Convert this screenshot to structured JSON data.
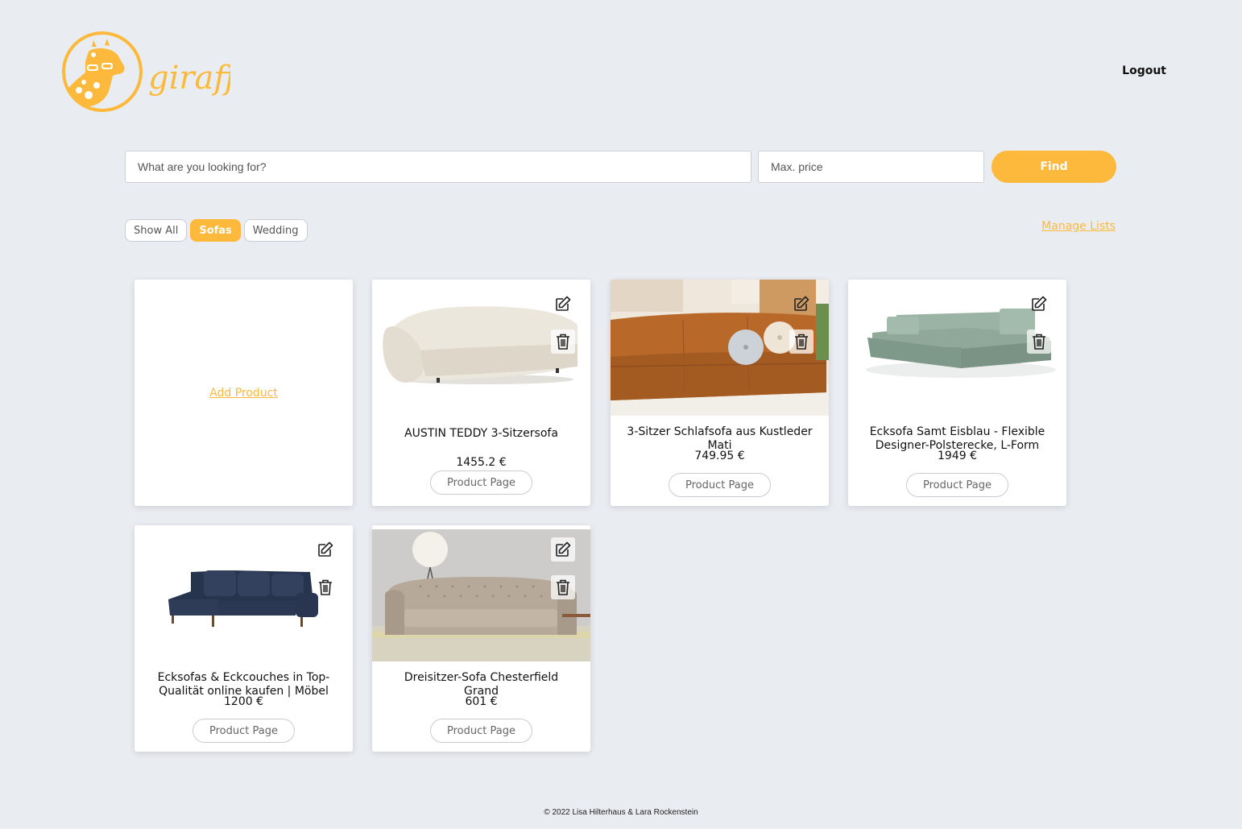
{
  "brand": {
    "name": "giraffe",
    "color": "#fdb93b"
  },
  "header": {
    "logout_label": "Logout"
  },
  "search": {
    "query_placeholder": "What are you looking for?",
    "price_placeholder": "Max. price",
    "find_label": "Find"
  },
  "filters": [
    {
      "label": "Show All",
      "active": false
    },
    {
      "label": "Sofas",
      "active": true
    },
    {
      "label": "Wedding",
      "active": false
    }
  ],
  "manage_lists_label": "Manage Lists",
  "add_product_label": "Add Product",
  "products": [
    {
      "title": "AUSTIN TEDDY 3-Sitzersofa",
      "price": "1455.2 €",
      "button": "Product Page"
    },
    {
      "title": "3-Sitzer Schlafsofa aus Kustleder Mati",
      "price": "749.95 €",
      "button": "Product Page"
    },
    {
      "title": "Ecksofa Samt Eisblau - Flexible Designer-Polsterecke, L-Form",
      "price": "1949 €",
      "button": "Product Page"
    },
    {
      "title": "Ecksofas & Eckcouches in Top-Qualität online kaufen | Möbel",
      "price": "1200 €",
      "button": "Product Page"
    },
    {
      "title": "Dreisitzer-Sofa Chesterfield Grand",
      "price": "601 €",
      "button": "Product Page"
    }
  ],
  "footer": {
    "text": "© 2022 Lisa Hilterhaus & Lara Rockenstein"
  }
}
